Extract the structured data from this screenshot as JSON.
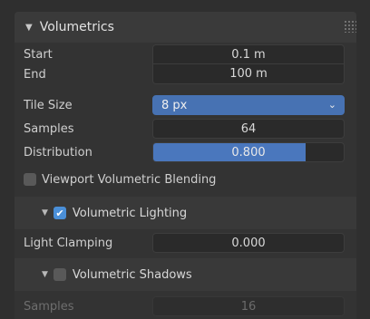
{
  "panel": {
    "title": "Volumetrics",
    "collapse_icon": "triangle-down-icon",
    "grip_icon": "drag-grip-icon"
  },
  "fields": {
    "start": {
      "label": "Start",
      "value": "0.1 m"
    },
    "end": {
      "label": "End",
      "value": "100 m"
    },
    "tile_size": {
      "label": "Tile Size",
      "value": "8 px"
    },
    "samples": {
      "label": "Samples",
      "value": "64"
    },
    "distribution": {
      "label": "Distribution",
      "value": "0.800",
      "fraction": 0.8
    }
  },
  "viewport_blending": {
    "label": "Viewport Volumetric Blending",
    "checked": false
  },
  "volumetric_lighting": {
    "label": "Volumetric Lighting",
    "checked": true
  },
  "light_clamping": {
    "label": "Light Clamping",
    "value": "0.000"
  },
  "volumetric_shadows": {
    "label": "Volumetric Shadows",
    "checked": false
  },
  "shadow_samples": {
    "label": "Samples",
    "value": "16",
    "disabled": true
  },
  "colors": {
    "accent": "#4772b3",
    "checkbox_on": "#4a8fd8"
  }
}
